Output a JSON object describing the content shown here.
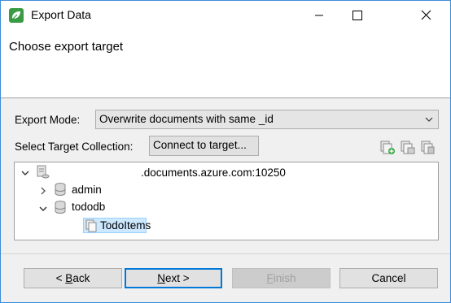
{
  "window": {
    "title": "Export Data",
    "icon": "app-leaf-icon",
    "accent": "#3c8cd6"
  },
  "header": {
    "title": "Choose export target"
  },
  "form": {
    "export_mode_label": "Export Mode:",
    "export_mode_value": "Overwrite documents with same _id",
    "target_collection_label": "Select Target Collection:",
    "connect_label": "Connect to target..."
  },
  "tree": {
    "root": {
      "label": ".documents.azure.com:10250",
      "icon": "server-icon",
      "expanded": true
    },
    "children": [
      {
        "label": "admin",
        "icon": "database-icon",
        "expanded": false
      },
      {
        "label": "tododb",
        "icon": "database-icon",
        "expanded": true,
        "children": [
          {
            "label": "TodoItems",
            "icon": "collection-icon",
            "selected": true
          }
        ]
      }
    ]
  },
  "buttons": {
    "back": {
      "prefix": "< ",
      "mnemonic": "B",
      "rest": "ack"
    },
    "next": {
      "mnemonic": "N",
      "rest": "ext >"
    },
    "finish": {
      "mnemonic": "F",
      "rest": "inish",
      "disabled": true
    },
    "cancel": "Cancel"
  }
}
